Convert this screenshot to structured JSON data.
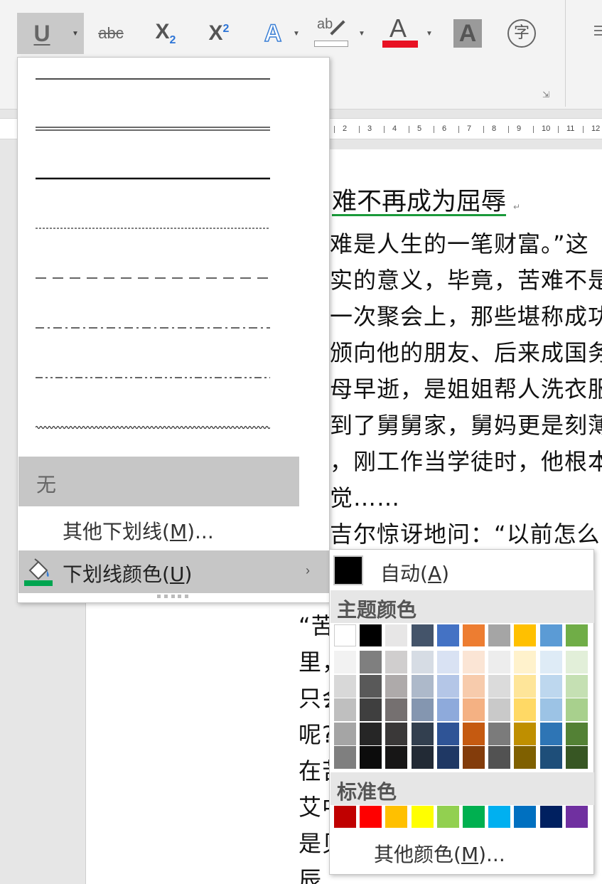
{
  "ribbon": {
    "underline_icon": "U",
    "strike_icon": "abc",
    "subscript_base": "X",
    "subscript_sub": "2",
    "superscript_base": "X",
    "superscript_sup": "2",
    "text_effects_icon": "A",
    "highlight_icon": "ab",
    "font_color_icon": "A",
    "char_shading_icon": "A",
    "enclose_char_icon": "字",
    "launcher_icon": "⇲",
    "colors": {
      "font_color_bar": "#e81123",
      "active_bg": "#c9c9c9"
    }
  },
  "ruler": {
    "ticks": [
      "2",
      "3",
      "4",
      "5",
      "6",
      "7",
      "8",
      "9",
      "10",
      "11",
      "12"
    ]
  },
  "document": {
    "title": "难不再成为屈辱",
    "para_mark": "↵",
    "lines_right": [
      "难是人生的一笔财富。”这",
      "实的意义，毕竟，苦难不是",
      "一次聚会上，那些堪称成功",
      "颁向他的朋友、后来成国务",
      "母早逝，是姐姐帮人洗衣服",
      "到了舅舅家，舅妈更是刻薄",
      "，刚工作当学徒时，他根本",
      "觉……",
      "吉尔惊讶地问：“以前怎么"
    ],
    "lines_left": [
      "“苦",
      "里，",
      "只会",
      "呢?",
      "在苦",
      "艾中",
      "是贝",
      "辰"
    ]
  },
  "underline_menu": {
    "styles": [
      "single",
      "double",
      "thick",
      "dotted",
      "dashed",
      "dash-dot",
      "dash-dot-dot",
      "wave"
    ],
    "none_label": "无",
    "more_label": "其他下划线(M)...",
    "color_label": "下划线颜色(U)",
    "submenu_arrow": "›",
    "paint_icon": "paint-bucket-icon",
    "paint_bar_color": "#00a550"
  },
  "color_picker": {
    "auto_label": "自动(A)",
    "theme_title": "主题颜色",
    "standard_title": "标准色",
    "more_label": "其他颜色(M)...",
    "theme_colors": [
      "#ffffff",
      "#000000",
      "#e7e6e6",
      "#44546a",
      "#4472c4",
      "#ed7d31",
      "#a5a5a5",
      "#ffc000",
      "#5b9bd5",
      "#70ad47"
    ],
    "theme_shades": [
      [
        "#f2f2f2",
        "#7f7f7f",
        "#d0cece",
        "#d6dce4",
        "#d9e2f3",
        "#fbe5d5",
        "#ededed",
        "#fff2cc",
        "#deebf6",
        "#e2efd9"
      ],
      [
        "#d8d8d8",
        "#595959",
        "#aeaaaa",
        "#adb9ca",
        "#b4c6e7",
        "#f7cbac",
        "#dbdbdb",
        "#fee599",
        "#bdd7ee",
        "#c5e0b3"
      ],
      [
        "#bfbfbf",
        "#3f3f3f",
        "#757070",
        "#8496b0",
        "#8eaadb",
        "#f4b183",
        "#c9c9c9",
        "#ffd965",
        "#9cc3e5",
        "#a8d08d"
      ],
      [
        "#a5a5a5",
        "#262626",
        "#3a3838",
        "#323f4f",
        "#2f5496",
        "#c55a11",
        "#7b7b7b",
        "#bf8f00",
        "#2e75b5",
        "#538135"
      ],
      [
        "#7f7f7f",
        "#0c0c0c",
        "#171616",
        "#222a35",
        "#1f3864",
        "#833c0b",
        "#525252",
        "#7f6000",
        "#1e4e79",
        "#375623"
      ]
    ],
    "standard_colors": [
      "#c00000",
      "#ff0000",
      "#ffc000",
      "#ffff00",
      "#92d050",
      "#00b050",
      "#00b0f0",
      "#0070c0",
      "#002060",
      "#7030a0"
    ]
  }
}
